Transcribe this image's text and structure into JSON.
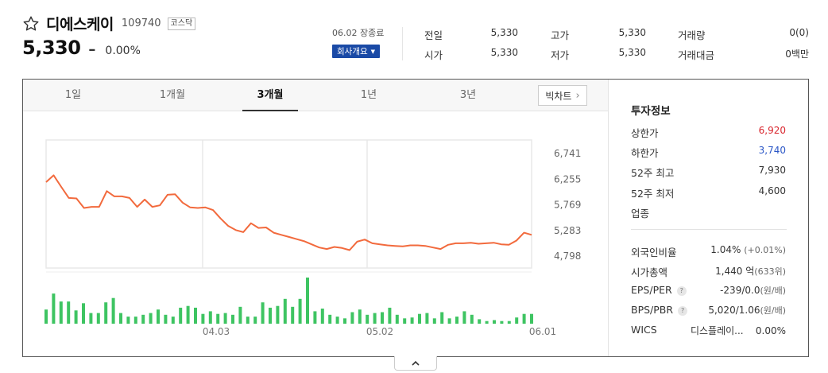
{
  "header": {
    "stock_name": "디에스케이",
    "stock_code": "109740",
    "market_badge": "코스닥",
    "price": "5,330",
    "change_symbol": "–",
    "change_pct": "0.00%",
    "close_date": "06.02 장종료",
    "company_button": "회사개요"
  },
  "summary": [
    {
      "label": "전일",
      "value": "5,330"
    },
    {
      "label": "시가",
      "value": "5,330"
    },
    {
      "label": "고가",
      "value": "5,330"
    },
    {
      "label": "저가",
      "value": "5,330"
    },
    {
      "label": "거래량",
      "value": "0(0)"
    },
    {
      "label": "거래대금",
      "value": "0백만"
    }
  ],
  "tabs": [
    "1일",
    "1개월",
    "3개월",
    "1년",
    "3년"
  ],
  "active_tab": "3개월",
  "big_chart_button": "빅차트",
  "chart_data": {
    "type": "line",
    "y_ticks": [
      "6,741",
      "6,255",
      "5,769",
      "5,283",
      "4,798"
    ],
    "ylim": [
      4570,
      7000
    ],
    "x_labels": [
      "04.03",
      "05.02",
      "06.01"
    ],
    "series": [
      {
        "values": [
          6200,
          6330,
          6110,
          5900,
          5890,
          5710,
          5730,
          5730,
          6030,
          5930,
          5930,
          5900,
          5730,
          5870,
          5730,
          5760,
          5960,
          5970,
          5810,
          5720,
          5710,
          5720,
          5670,
          5510,
          5370,
          5290,
          5250,
          5420,
          5330,
          5340,
          5240,
          5200,
          5160,
          5120,
          5080,
          5020,
          4960,
          4930,
          4970,
          4950,
          4910,
          5070,
          5110,
          5040,
          5020,
          5000,
          4990,
          4980,
          5000,
          5000,
          4990,
          4960,
          4930,
          5010,
          5040,
          5040,
          5050,
          5030,
          5040,
          5050,
          5020,
          5010,
          5090,
          5240,
          5200
        ]
      }
    ],
    "volume_series": [
      {
        "values": [
          16,
          34,
          25,
          25,
          15,
          23,
          12,
          12,
          24,
          29,
          12,
          8,
          8,
          10,
          12,
          16,
          10,
          8,
          18,
          20,
          18,
          11,
          14,
          11,
          12,
          10,
          19,
          8,
          8,
          24,
          18,
          20,
          28,
          19,
          28,
          52,
          14,
          17,
          10,
          8,
          6,
          13,
          16,
          10,
          12,
          13,
          18,
          10,
          6,
          7,
          11,
          12,
          6,
          13,
          6,
          8,
          14,
          10,
          5,
          3,
          4,
          3,
          3,
          7,
          11,
          11
        ]
      }
    ]
  },
  "side": {
    "title": "투자정보",
    "rows": [
      {
        "label": "상한가",
        "value": "6,920",
        "tone": "up"
      },
      {
        "label": "하한가",
        "value": "3,740",
        "tone": "down"
      },
      {
        "label": "52주 최고",
        "value": "7,930",
        "tone": ""
      },
      {
        "label": "52주 최저",
        "value": "4,600",
        "tone": ""
      },
      {
        "label": "업종",
        "value": "",
        "tone": ""
      }
    ],
    "rows2": [
      {
        "label": "외국인비율",
        "value": "1.04%",
        "sub": "(+0.01%)",
        "help": false
      },
      {
        "label": "시가총액",
        "value": "1,440 억",
        "sub": "(633위)",
        "help": false
      },
      {
        "label": "EPS/PER",
        "value": "-239/0.0",
        "sub": "(원/배)",
        "help": true
      },
      {
        "label": "BPS/PBR",
        "value": "5,020/1.06",
        "sub": "(원/배)",
        "help": true
      },
      {
        "label": "WICS",
        "value": "디스플레이...",
        "sub": "0.00%",
        "help": false
      }
    ],
    "help_glyph": "?"
  },
  "colors": {
    "line": "#f26a3d",
    "volume": "#3ec462",
    "up": "#d9262e",
    "down": "#2a56c6",
    "active_button": "#1a4aa6"
  }
}
